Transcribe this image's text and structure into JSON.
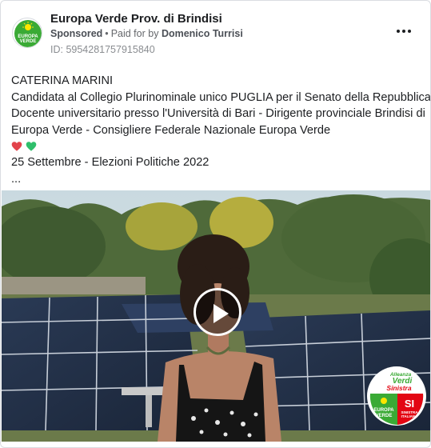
{
  "post": {
    "page_name": "Europa Verde Prov. di Brindisi",
    "sponsored_label": "Sponsored",
    "separator": "•",
    "paid_for_prefix": "Paid for by",
    "payer": "Domenico Turrisi",
    "ad_id": "ID: 5954281757915840",
    "more_icon": "more-horizontal-icon",
    "avatar_icon": "europa-verde-logo",
    "avatar_text": {
      "line1": "EUROPA",
      "line2": "VERDE"
    }
  },
  "body": {
    "lines": [
      "CATERINA MARINI",
      "Candidata al Collegio Plurinominale unico PUGLIA per il Senato della Repubblica.",
      "Docente universitario presso l'Università di Bari - Dirigente provinciale Brindisi di",
      "Europa Verde - Consigliere Federale Nazionale Europa Verde"
    ],
    "emoji": [
      "red-heart-icon",
      "green-heart-icon"
    ],
    "date_line": "25 Settembre - Elezioni Politiche 2022",
    "ellipsis": "..."
  },
  "media": {
    "type": "video",
    "play_icon": "play-icon",
    "badge": {
      "top_line1": "Alleanza",
      "top_line2": "Verdi",
      "top_line3": "Sinistra",
      "left_line1": "EUROPA",
      "left_line2": "VERDE",
      "right_big": "SI",
      "right_small1": "SINISTRA",
      "right_small2": "ITALIANA"
    }
  },
  "colors": {
    "text": "#1c1e21",
    "secondary": "#65676b",
    "brand_green": "#3aaa35",
    "brand_red": "#e30613",
    "heart_red": "#e2434b",
    "heart_green": "#2fbf6b"
  }
}
